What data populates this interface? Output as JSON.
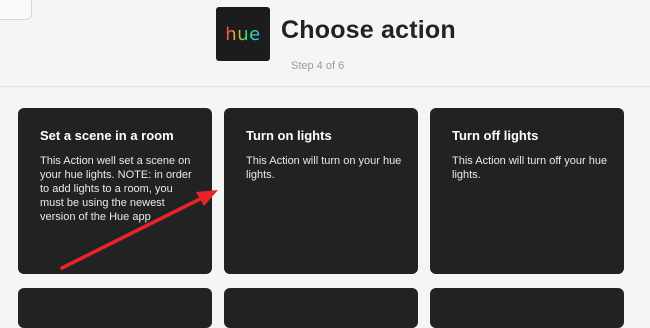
{
  "header": {
    "logo_text": "hue",
    "title": "Choose action",
    "step": "Step 4 of 6"
  },
  "actions": [
    {
      "title": "Set a scene in a room",
      "description": "This Action well set a scene on your hue lights. NOTE: in order to add lights to a room, you must be using the newest version of the Hue app"
    },
    {
      "title": "Turn on lights",
      "description": "This Action will turn on your hue lights."
    },
    {
      "title": "Turn off lights",
      "description": "This Action will turn off your hue lights."
    }
  ],
  "colors": {
    "card_background": "#222222",
    "annotation_arrow": "#e8242a",
    "page_background": "#f5f5f5"
  }
}
